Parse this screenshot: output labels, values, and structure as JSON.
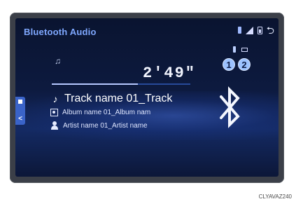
{
  "header": {
    "title": "Bluetooth Audio"
  },
  "status_icons": [
    "bluetooth-icon",
    "signal-icon",
    "battery-icon",
    "back-icon"
  ],
  "phone_icons": [
    "phone-icon",
    "phone-2-icon"
  ],
  "devices": [
    "1",
    "2"
  ],
  "player": {
    "elapsed_time": "2'49\"",
    "progress_fraction": 0.62,
    "track": "Track name 01_Track",
    "album": "Album name 01_Album nam",
    "artist": "Artist name 01_Artist name"
  },
  "side_tab": {
    "chevron": "<"
  },
  "caption": "CLYAVAZ240",
  "colors": {
    "title": "#7fa8ff",
    "screen_bg": "#0d1a3f",
    "highlight": "#9cc2ff"
  }
}
